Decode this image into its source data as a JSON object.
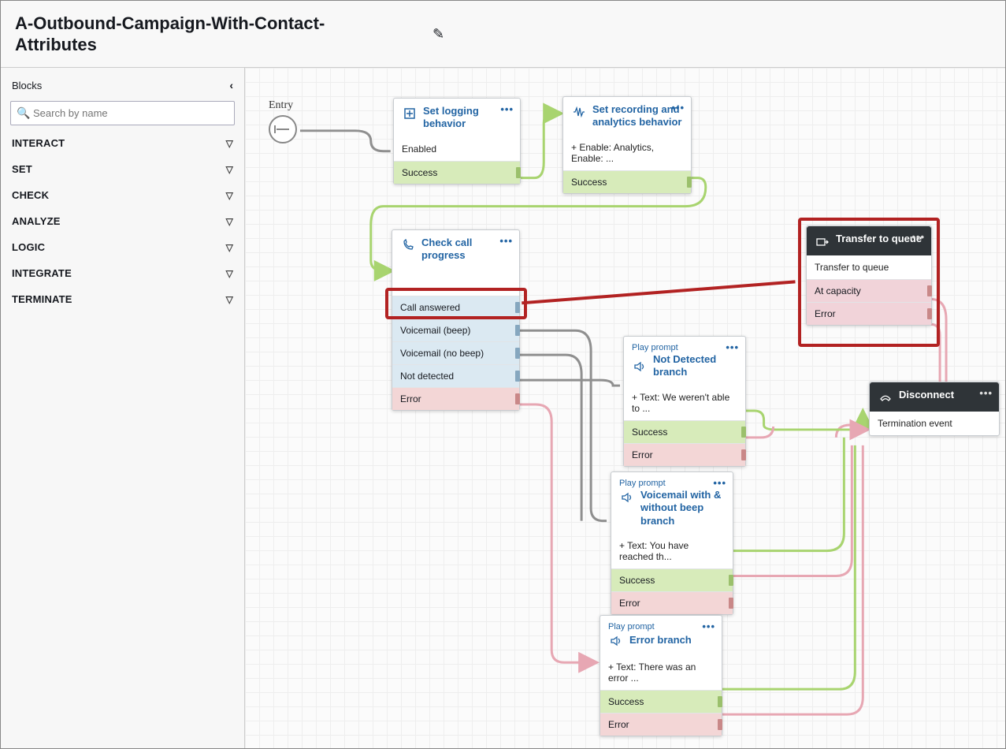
{
  "header": {
    "title": "A-Outbound-Campaign-With-Contact-Attributes"
  },
  "sidebar": {
    "title": "Blocks",
    "search_placeholder": "Search by name",
    "categories": [
      "INTERACT",
      "SET",
      "CHECK",
      "ANALYZE",
      "LOGIC",
      "INTEGRATE",
      "TERMINATE"
    ]
  },
  "entry": {
    "label": "Entry"
  },
  "nodes": {
    "logging": {
      "title": "Set logging behavior",
      "body": "Enabled",
      "outs": [
        "Success"
      ]
    },
    "recording": {
      "title": "Set recording and analytics behavior",
      "body": "+  Enable: Analytics, Enable: ...",
      "outs": [
        "Success"
      ]
    },
    "check": {
      "title": "Check call progress",
      "outs": [
        "Call answered",
        "Voicemail (beep)",
        "Voicemail (no beep)",
        "Not detected",
        "Error"
      ]
    },
    "transfer": {
      "title": "Transfer to queue",
      "body": "Transfer to queue",
      "outs": [
        "At capacity",
        "Error"
      ]
    },
    "pp_nd": {
      "eyebrow": "Play prompt",
      "title": "Not Detected branch",
      "body": "+  Text: We weren't able to ...",
      "outs": [
        "Success",
        "Error"
      ]
    },
    "pp_vm": {
      "eyebrow": "Play prompt",
      "title": "Voicemail with & without beep branch",
      "body": "+  Text: You have reached th...",
      "outs": [
        "Success",
        "Error"
      ]
    },
    "pp_err": {
      "eyebrow": "Play prompt",
      "title": "Error branch",
      "body": "+  Text: There was an error ...",
      "outs": [
        "Success",
        "Error"
      ]
    },
    "disconnect": {
      "title": "Disconnect",
      "body": "Termination event"
    }
  }
}
